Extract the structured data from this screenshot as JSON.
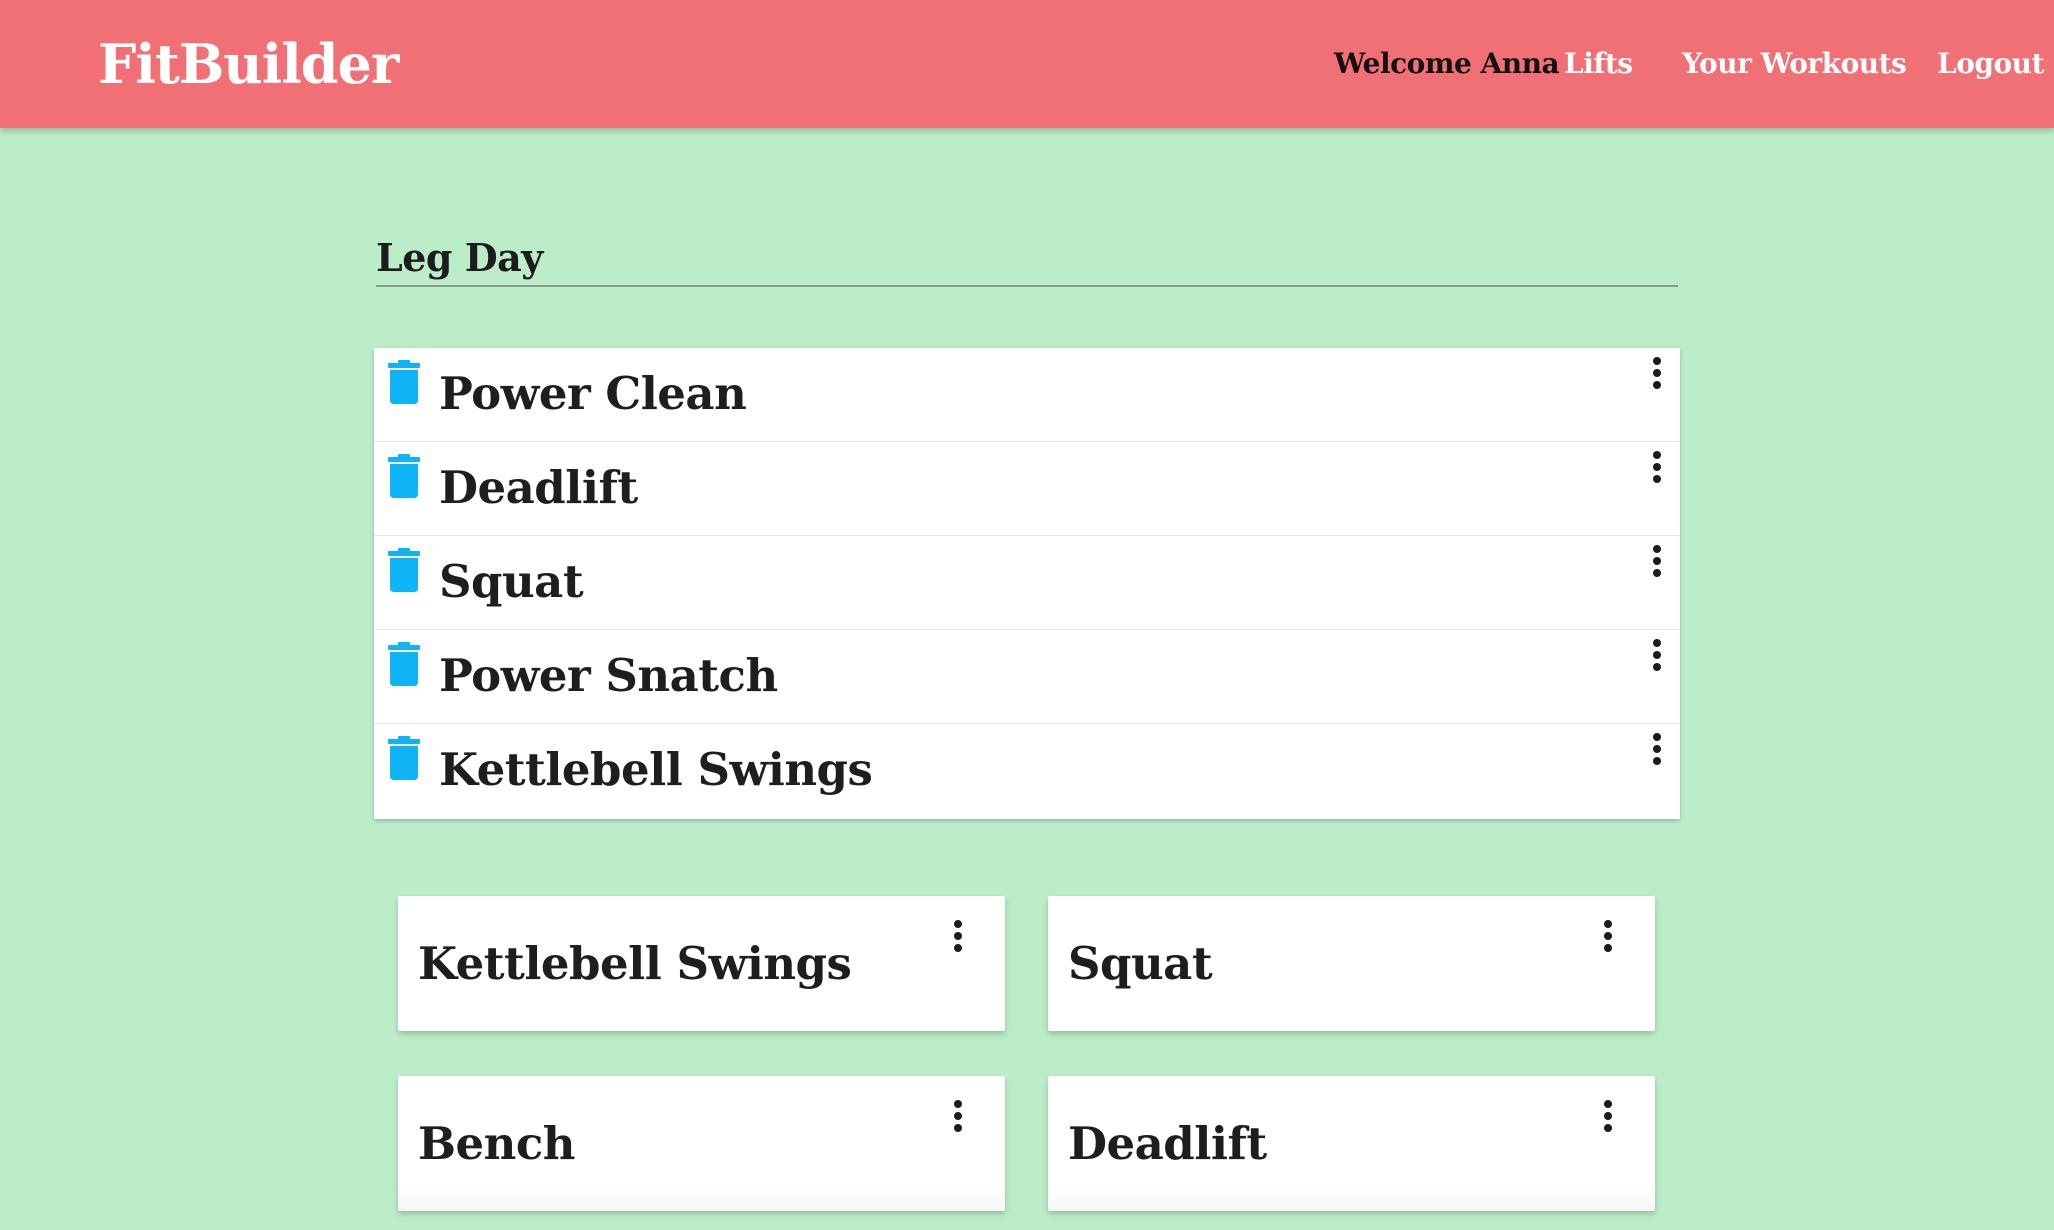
{
  "header": {
    "brand": "FitBuilder",
    "welcome": "Welcome Anna",
    "nav": {
      "lifts": "Lifts",
      "workouts": "Your Workouts",
      "logout": "Logout"
    }
  },
  "colors": {
    "header_bg": "#f07075",
    "page_bg": "#bbedc8",
    "trash_icon": "#0eb4f5"
  },
  "workout": {
    "title": "Leg Day",
    "items": [
      {
        "label": "Power Clean",
        "delete_icon": "trash-icon",
        "menu_icon": "more-vert-icon"
      },
      {
        "label": "Deadlift",
        "delete_icon": "trash-icon",
        "menu_icon": "more-vert-icon"
      },
      {
        "label": "Squat",
        "delete_icon": "trash-icon",
        "menu_icon": "more-vert-icon"
      },
      {
        "label": "Power Snatch",
        "delete_icon": "trash-icon",
        "menu_icon": "more-vert-icon"
      },
      {
        "label": "Kettlebell Swings",
        "delete_icon": "trash-icon",
        "menu_icon": "more-vert-icon"
      }
    ]
  },
  "lifts": {
    "cards": [
      {
        "label": "Kettlebell Swings",
        "menu_icon": "more-vert-icon"
      },
      {
        "label": "Squat",
        "menu_icon": "more-vert-icon"
      },
      {
        "label": "Bench",
        "menu_icon": "more-vert-icon"
      },
      {
        "label": "Deadlift",
        "menu_icon": "more-vert-icon"
      }
    ]
  }
}
